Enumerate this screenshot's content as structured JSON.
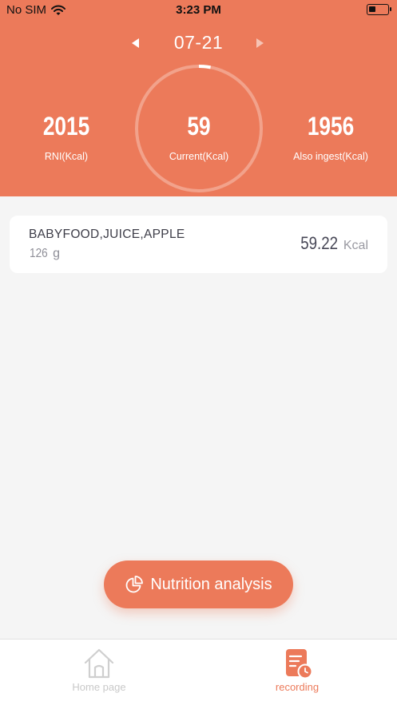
{
  "status_bar": {
    "carrier": "No SIM",
    "time": "3:23 PM",
    "battery_level": 0.35
  },
  "header": {
    "date": "07-21",
    "progress": 0.03,
    "stats": {
      "rni": {
        "value": "2015",
        "label": "RNI(Kcal)"
      },
      "current": {
        "value": "59",
        "label": "Current(Kcal)"
      },
      "remaining": {
        "value": "1956",
        "label": "Also ingest(Kcal)"
      }
    }
  },
  "food_items": [
    {
      "name": "BABYFOOD,JUICE,APPLE",
      "weight_value": "126",
      "weight_unit": "g",
      "kcal_value": "59.22",
      "kcal_unit": "Kcal"
    }
  ],
  "action_button": {
    "label": "Nutrition analysis",
    "icon": "pie-chart-icon"
  },
  "tab_bar": {
    "tabs": [
      {
        "label": "Home page",
        "icon": "home-icon",
        "active": false
      },
      {
        "label": "recording",
        "icon": "record-icon",
        "active": true
      }
    ]
  },
  "colors": {
    "accent": "#ec7a5a",
    "background": "#f5f5f5",
    "inactive": "#c9c9c9"
  }
}
